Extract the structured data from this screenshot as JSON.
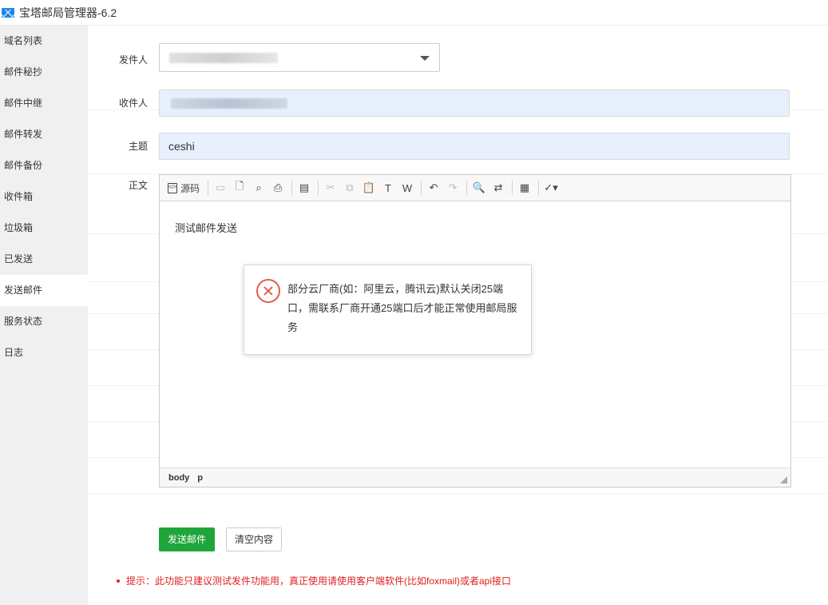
{
  "window": {
    "title": "宝塔邮局管理器-6.2"
  },
  "sidebar": {
    "items": [
      {
        "label": "域名列表"
      },
      {
        "label": "邮件秘抄"
      },
      {
        "label": "邮件中继"
      },
      {
        "label": "邮件转发"
      },
      {
        "label": "邮件备份"
      },
      {
        "label": "收件箱"
      },
      {
        "label": "垃圾箱"
      },
      {
        "label": "已发送"
      },
      {
        "label": "发送邮件",
        "active": true
      },
      {
        "label": "服务状态"
      },
      {
        "label": "日志"
      }
    ]
  },
  "form": {
    "sender_label": "发件人",
    "recipient_label": "收件人",
    "subject_label": "主题",
    "subject_value": "ceshi",
    "body_label": "正文"
  },
  "editor": {
    "source_label": "源码",
    "content": "测试邮件发送",
    "path": [
      "body",
      "p"
    ]
  },
  "dialog": {
    "message": "部分云厂商(如：阿里云，腾讯云)默认关闭25端口，需联系厂商开通25端口后才能正常使用邮局服务"
  },
  "actions": {
    "send_label": "发送邮件",
    "clear_label": "清空内容"
  },
  "tip": "提示：此功能只建议测试发件功能用，真正使用请使用客户端软件(比如foxmail)或者api接口",
  "colors": {
    "primary": "#20a53a",
    "error": "#e55a4e",
    "tip": "#e02020",
    "input_bg": "#e8f0fe"
  }
}
